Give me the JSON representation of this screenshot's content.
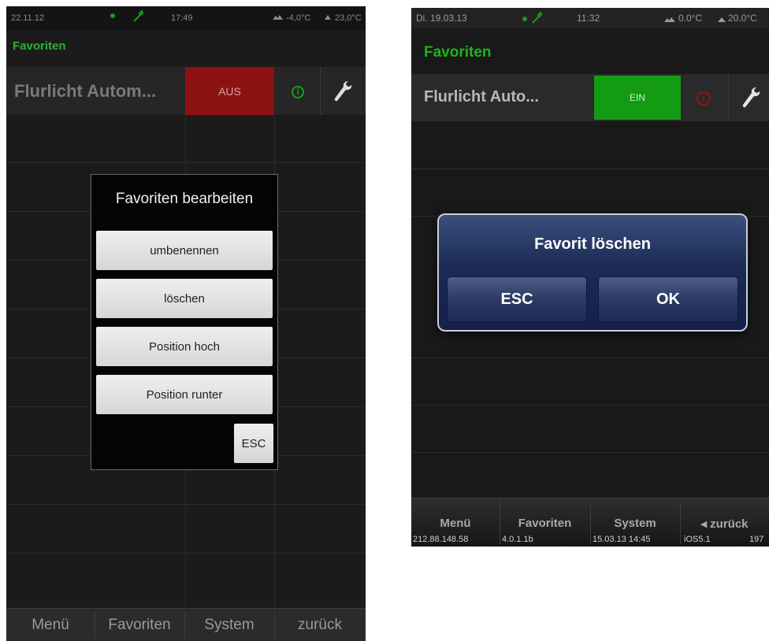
{
  "left": {
    "status": {
      "date": "22.11.12",
      "time": "17:49",
      "outdoor_temp": "-4,0°C",
      "indoor_temp": "23,0°C"
    },
    "section_title": "Favoriten",
    "favorite_row": {
      "name": "Flurlicht Autom...",
      "state": "AUS",
      "info_symbol": "i"
    },
    "dialog": {
      "title": "Favoriten bearbeiten",
      "buttons": [
        "umbenennen",
        "löschen",
        "Position hoch",
        "Position runter"
      ],
      "esc": "ESC"
    },
    "tabs": [
      "Menü",
      "Favoriten",
      "System",
      "zurück"
    ],
    "colors": {
      "accent": "#2db22d",
      "off_button": "#8c1212"
    },
    "icons": [
      "connection-dot-icon",
      "wrench-icon",
      "outdoor-temp-icon",
      "indoor-temp-icon",
      "info-icon"
    ]
  },
  "right": {
    "status": {
      "date": "Di. 19.03.13",
      "time": "11:32",
      "outdoor_temp": "0.0°C",
      "indoor_temp": "20.0°C"
    },
    "section_title": "Favoriten",
    "favorite_row": {
      "name": "Flurlicht Auto...",
      "state": "EIN",
      "info_symbol": "i"
    },
    "dialog": {
      "title": "Favorit löschen",
      "esc": "ESC",
      "ok": "OK"
    },
    "tabs": [
      {
        "label": "Menü",
        "sub": "212.88.148.58"
      },
      {
        "label": "Favoriten",
        "sub": "4.0.1.1b"
      },
      {
        "label": "System",
        "sub": "15.03.13 14:45"
      },
      {
        "label": "◂ zurück",
        "sub": "iOS5.1",
        "sub2": "197"
      }
    ],
    "colors": {
      "accent": "#1fb31f",
      "on_button": "#139b13",
      "dialog": "#1c2b55"
    },
    "icons": [
      "connection-dot-icon",
      "wrench-icon",
      "outdoor-temp-icon",
      "indoor-temp-icon",
      "info-icon"
    ]
  }
}
